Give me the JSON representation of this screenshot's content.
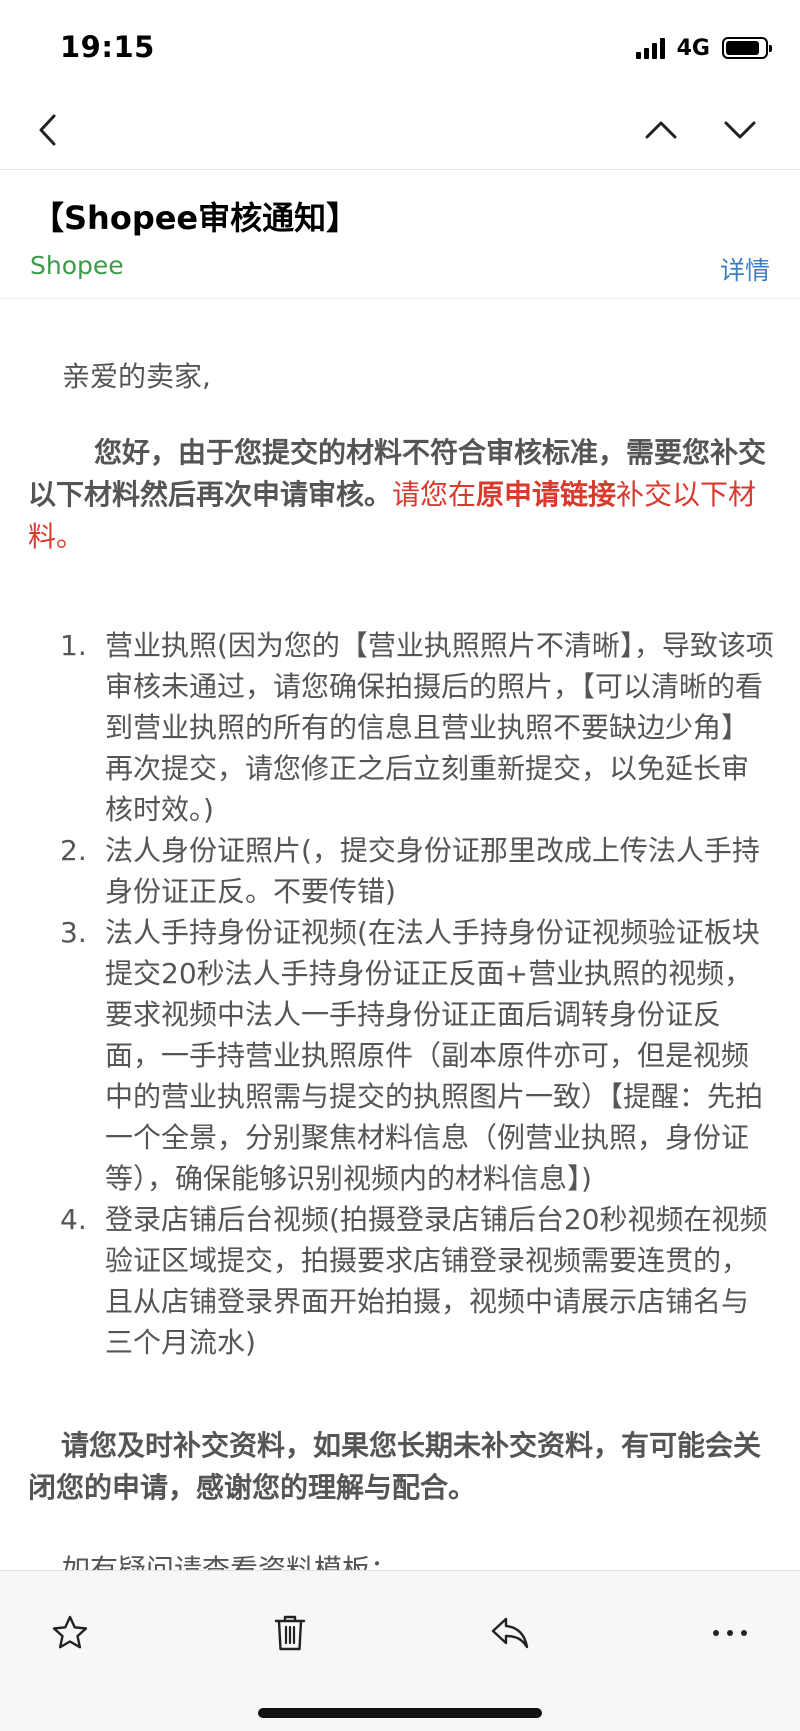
{
  "status_bar": {
    "time": "19:15",
    "network": "4G"
  },
  "email": {
    "subject": "【Shopee审核通知】",
    "sender": "Shopee",
    "details_label": "详情",
    "greeting": "亲爱的卖家,",
    "para1": {
      "bold": "您好，由于您提交的材料不符合审核标准，需要您补交以下材料然后再次申请审核。",
      "red_a": "请您在",
      "red_bold": "原申请链接",
      "red_b": "补交以下材料。"
    },
    "requirements": [
      {
        "num": "1.",
        "text": "营业执照(因为您的【营业执照照片不清晰】，导致该项审核未通过，请您确保拍摄后的照片，【可以清晰的看到营业执照的所有的信息且营业执照不要缺边少角】再次提交，请您修正之后立刻重新提交，以免延长审核时效。)"
      },
      {
        "num": "2.",
        "text": "法人身份证照片(，提交身份证那里改成上传法人手持身份证正反。不要传错)"
      },
      {
        "num": "3.",
        "text": "法人手持身份证视频(在法人手持身份证视频验证板块提交20秒法人手持身份证正反面+营业执照的视频，要求视频中法人一手持身份证正面后调转身份证反面，一手持营业执照原件（副本原件亦可，但是视频中的营业执照需与提交的执照图片一致）【提醒：先拍一个全景，分别聚焦材料信息（例营业执照，身份证等），确保能够识别视频内的材料信息】)"
      },
      {
        "num": "4.",
        "text": "登录店铺后台视频(拍摄登录店铺后台20秒视频在视频验证区域提交，拍摄要求店铺登录视频需要连贯的，且从店铺登录界面开始拍摄，视频中请展示店铺名与三个月流水)"
      }
    ],
    "para2": "请您及时补交资料，如果您长期未补交资料，有可能会关闭您的申请，感谢您的理解与配合。",
    "para3": "如有疑问请查看资料模板："
  },
  "colors": {
    "sender": "#3d9a4a",
    "link": "#3f7fbf",
    "highlight": "#d83a2e"
  },
  "icons": {
    "back": "chevron-left-icon",
    "prev": "chevron-up-icon",
    "next": "chevron-down-icon",
    "star": "star-icon",
    "trash": "trash-icon",
    "reply": "reply-icon",
    "more": "more-icon"
  }
}
